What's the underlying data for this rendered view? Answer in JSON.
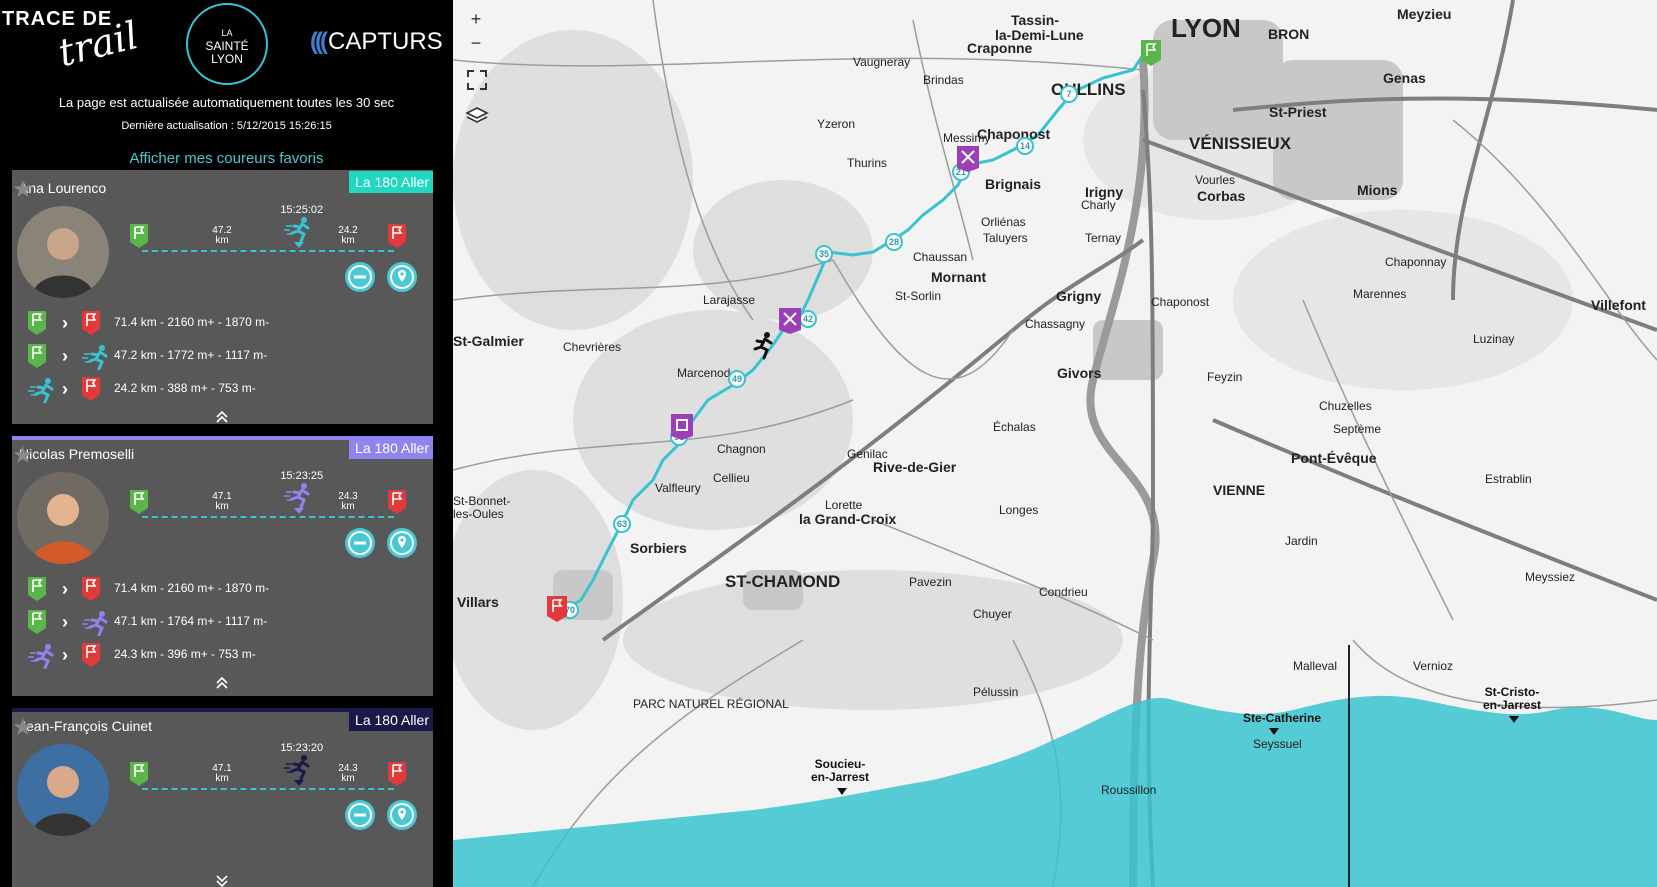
{
  "header": {
    "logo_trace_line1": "TRACE DE",
    "logo_trace_line2": "trail",
    "logo_saintelyon_1": "LA",
    "logo_saintelyon_2": "SAINTÉ",
    "logo_saintelyon_3": "LYON",
    "logo_capturs": "CAPTURS",
    "refresh_notice": "La page est actualisée automatiquement toutes les 30 sec",
    "last_update": "Dernière actualisation : 5/12/2015 15:26:15",
    "favorites_link": "Afficher mes coureurs favoris"
  },
  "runners": [
    {
      "name": "Ana Lourenco",
      "badge": "La 180 Aller",
      "badge_color": "#1fd8c0",
      "accent": "#37c3cf",
      "time": "15:25:02",
      "km_done": "47.2",
      "km_left": "24.2",
      "km_unit": "km",
      "progress": 0.66,
      "stats": [
        {
          "text": "71.4 km - 2160 m+ - 1870 m-"
        },
        {
          "text": "47.2 km - 1772 m+ - 1117 m-"
        },
        {
          "text": "24.2 km - 388 m+ - 753 m-"
        }
      ]
    },
    {
      "name": "Nicolas Premoselli",
      "badge": "La 180 Aller",
      "badge_color": "#8f84f0",
      "accent": "#8f84f0",
      "time": "15:23:25",
      "km_done": "47.1",
      "km_left": "24.3",
      "km_unit": "km",
      "progress": 0.66,
      "stats": [
        {
          "text": "71.4 km - 2160 m+ - 1870 m-"
        },
        {
          "text": "47.1 km - 1764 m+ - 1117 m-"
        },
        {
          "text": "24.3 km - 396 m+ - 753 m-"
        }
      ]
    },
    {
      "name": "Jean-François Cuinet",
      "badge": "La 180 Aller",
      "badge_color": "#1a1a4a",
      "accent": "#1a1a4a",
      "time": "15:23:20",
      "km_done": "47.1",
      "km_left": "24.3",
      "km_unit": "km",
      "progress": 0.66
    }
  ],
  "map": {
    "zoom_in": "+",
    "zoom_out": "−",
    "labels": [
      {
        "t": "LYON",
        "c": "city"
      },
      {
        "t": "BRON",
        "c": "mid"
      },
      {
        "t": "Meyzieu",
        "c": "mid"
      },
      {
        "t": "Tassin-",
        "c": "mid"
      },
      {
        "t": "la-Demi-Lune",
        "c": "mid"
      },
      {
        "t": "Craponne",
        "c": "mid"
      },
      {
        "t": "OULLINS",
        "c": "big"
      },
      {
        "t": "Chaponost",
        "c": "mid"
      },
      {
        "t": "VÉNISSIEUX",
        "c": "big"
      },
      {
        "t": "St-Priest",
        "c": "mid"
      },
      {
        "t": "Genas",
        "c": "mid"
      },
      {
        "t": "Brignais",
        "c": "mid"
      },
      {
        "t": "Irigny",
        "c": "mid"
      },
      {
        "t": "Corbas",
        "c": "mid"
      },
      {
        "t": "Mions",
        "c": "mid"
      },
      {
        "t": "Mornant",
        "c": "mid"
      },
      {
        "t": "Grigny",
        "c": "mid"
      },
      {
        "t": "Givors",
        "c": "mid"
      },
      {
        "t": "Rive-de-Gier",
        "c": "mid"
      },
      {
        "t": "la Grand-Croix",
        "c": "mid"
      },
      {
        "t": "ST-CHAMOND",
        "c": "big"
      },
      {
        "t": "Sorbiers",
        "c": "mid"
      },
      {
        "t": "Villars",
        "c": "mid"
      },
      {
        "t": "VIENNE",
        "c": "mid"
      },
      {
        "t": "Pont-Évêque",
        "c": "mid"
      },
      {
        "t": "St-Galmier",
        "c": "mid"
      },
      {
        "t": "Villefont",
        "c": "mid"
      },
      {
        "t": "Roussillon",
        "c": ""
      },
      {
        "t": "PARC NATUREL RÉGIONAL",
        "c": ""
      },
      {
        "t": "St-Bonnet-",
        "c": ""
      },
      {
        "t": "les-Oules",
        "c": ""
      },
      {
        "t": "Chevrières",
        "c": ""
      },
      {
        "t": "Larajasse",
        "c": ""
      },
      {
        "t": "Marcenod",
        "c": ""
      },
      {
        "t": "Chagnon",
        "c": ""
      },
      {
        "t": "Cellieu",
        "c": ""
      },
      {
        "t": "Valfleury",
        "c": ""
      },
      {
        "t": "Thurins",
        "c": ""
      },
      {
        "t": "Messimy",
        "c": ""
      },
      {
        "t": "Yzeron",
        "c": ""
      },
      {
        "t": "Vaugneray",
        "c": ""
      },
      {
        "t": "Brindas",
        "c": ""
      },
      {
        "t": "Taluyers",
        "c": ""
      },
      {
        "t": "Orliénas",
        "c": ""
      },
      {
        "t": "Chaussan",
        "c": ""
      },
      {
        "t": "St-Sorlin",
        "c": ""
      },
      {
        "t": "Chassagny",
        "c": ""
      },
      {
        "t": "Échalas",
        "c": ""
      },
      {
        "t": "Longes",
        "c": ""
      },
      {
        "t": "Condrieu",
        "c": ""
      },
      {
        "t": "Pélussin",
        "c": ""
      },
      {
        "t": "Chuyer",
        "c": ""
      },
      {
        "t": "Pavezin",
        "c": ""
      },
      {
        "t": "Lorette",
        "c": ""
      },
      {
        "t": "Genilac",
        "c": ""
      },
      {
        "t": "Jardin",
        "c": ""
      },
      {
        "t": "Septème",
        "c": ""
      },
      {
        "t": "Marennes",
        "c": ""
      },
      {
        "t": "Chaponnay",
        "c": ""
      },
      {
        "t": "Luzinay",
        "c": ""
      },
      {
        "t": "Estrablin",
        "c": ""
      },
      {
        "t": "Meyssiez",
        "c": ""
      },
      {
        "t": "Vernioz",
        "c": ""
      },
      {
        "t": "Malleval",
        "c": ""
      },
      {
        "t": "Seyssuel",
        "c": ""
      },
      {
        "t": "Chuzelles",
        "c": ""
      },
      {
        "t": "Feyzin",
        "c": ""
      },
      {
        "t": "Vourles",
        "c": ""
      },
      {
        "t": "Charly",
        "c": ""
      },
      {
        "t": "Ternay",
        "c": ""
      },
      {
        "t": "Chaponost",
        "c": ""
      }
    ],
    "waypoints": [
      "7",
      "14",
      "21",
      "28",
      "35",
      "42",
      "49",
      "56",
      "63",
      "70"
    ],
    "elevation": {
      "labels": [
        {
          "t": "Soucieu-\nen-Jarrest"
        },
        {
          "t": "Ste-Catherine"
        },
        {
          "t": "St-Cristo-\nen-Jarrest"
        }
      ]
    }
  }
}
